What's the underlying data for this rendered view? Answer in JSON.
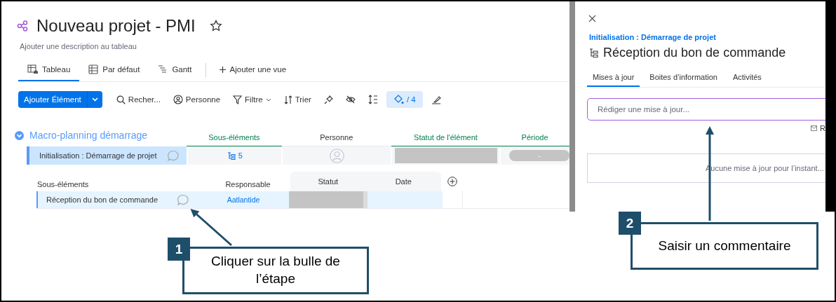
{
  "board": {
    "title": "Nouveau projet - PMI",
    "description": "Ajouter une description au tableau",
    "views": [
      {
        "kind": "table",
        "label": "Tableau",
        "selected": true
      },
      {
        "kind": "grid",
        "label": "Par défaut",
        "selected": false
      },
      {
        "kind": "gantt",
        "label": "Gantt",
        "selected": false
      }
    ],
    "add_view": "Ajouter une vue",
    "toolbar": {
      "primary": "Ajouter Élément",
      "items": [
        {
          "kind": "search",
          "label": "Recher..."
        },
        {
          "kind": "person",
          "label": "Personne"
        },
        {
          "kind": "filter",
          "label": "Filtre"
        },
        {
          "kind": "sort",
          "label": "Trier"
        },
        {
          "kind": "pin"
        },
        {
          "kind": "hide"
        },
        {
          "kind": "height"
        },
        {
          "kind": "color",
          "label": "/ 4",
          "active": true
        },
        {
          "kind": "format"
        }
      ]
    },
    "group": {
      "title": "Macro-planning démarrage",
      "expanded": true,
      "columns": [
        "Sous-éléments",
        "Personne",
        "Statut de l'élément",
        "Période"
      ],
      "rows": [
        {
          "name": "Initialisation : Démarrage de projet",
          "subitems": "5",
          "period": "-",
          "selected": true
        }
      ],
      "subitems": {
        "columns": [
          "Sous-éléments",
          "Responsable",
          "Statut",
          "Date"
        ],
        "rows": [
          {
            "name": "Réception du bon de commande",
            "owner": "Aatlantide",
            "selected": true
          }
        ]
      }
    }
  },
  "panel": {
    "breadcrumb": "Initialisation : Démarrage de projet",
    "title": "Réception du bon de commande",
    "tabs": [
      {
        "label": "Mises à jour",
        "selected": true
      },
      {
        "label": "Boites d’information",
        "selected": false
      },
      {
        "label": "Activités",
        "selected": false
      }
    ],
    "update_field": {
      "placeholder": "Rédiger une mise à jour..."
    },
    "mail_link": "R",
    "empty_message": "Aucune mise à jour pour l’instant..."
  },
  "callouts": [
    {
      "number": "1",
      "text": "Cliquer sur la bulle de l’étape"
    },
    {
      "number": "2",
      "text": "Saisir un commentaire"
    }
  ]
}
